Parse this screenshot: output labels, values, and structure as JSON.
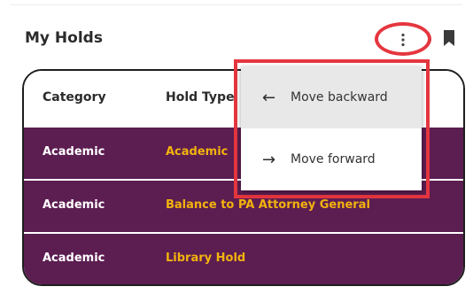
{
  "header": {
    "title": "My Holds",
    "more_icon": "vertical-ellipsis",
    "bookmark_icon": "bookmark"
  },
  "table": {
    "columns": [
      "Category",
      "Hold Type"
    ],
    "rows": [
      {
        "category": "Academic",
        "hold_type": "Academic"
      },
      {
        "category": "Academic",
        "hold_type": "Balance to PA Attorney General"
      },
      {
        "category": "Academic",
        "hold_type": "Library Hold"
      }
    ]
  },
  "menu": {
    "items": [
      {
        "icon": "←",
        "label": "Move backward"
      },
      {
        "icon": "→",
        "label": "Move forward"
      }
    ]
  },
  "colors": {
    "row_bg": "#5c1d51",
    "hold_type_text": "#f2b30d",
    "callout": "#e5363f"
  }
}
